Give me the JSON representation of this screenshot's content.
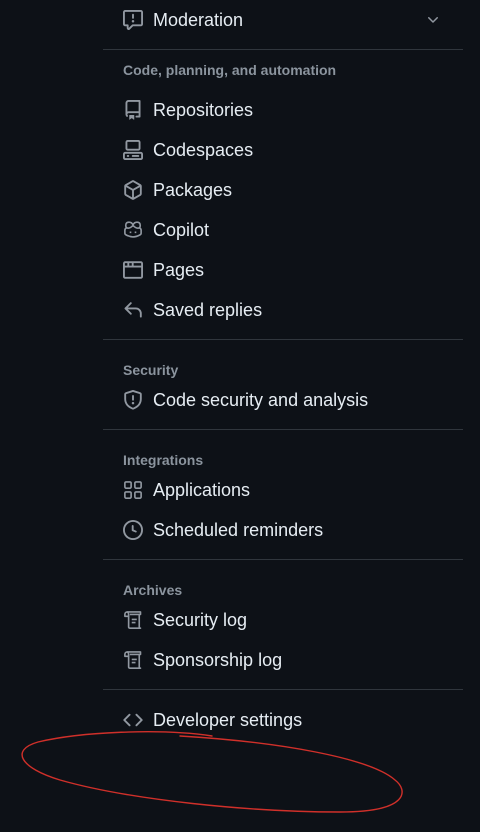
{
  "nav": {
    "moderation": {
      "label": "Moderation",
      "icon": "report-icon"
    },
    "code_planning": {
      "title": "Code, planning, and automation",
      "items": [
        {
          "label": "Repositories",
          "icon": "repo-icon"
        },
        {
          "label": "Codespaces",
          "icon": "codespaces-icon"
        },
        {
          "label": "Packages",
          "icon": "package-icon"
        },
        {
          "label": "Copilot",
          "icon": "copilot-icon"
        },
        {
          "label": "Pages",
          "icon": "browser-icon"
        },
        {
          "label": "Saved replies",
          "icon": "reply-icon"
        }
      ]
    },
    "security": {
      "title": "Security",
      "items": [
        {
          "label": "Code security and analysis",
          "icon": "shield-icon"
        }
      ]
    },
    "integrations": {
      "title": "Integrations",
      "items": [
        {
          "label": "Applications",
          "icon": "apps-icon"
        },
        {
          "label": "Scheduled reminders",
          "icon": "clock-icon"
        }
      ]
    },
    "archives": {
      "title": "Archives",
      "items": [
        {
          "label": "Security log",
          "icon": "log-icon"
        },
        {
          "label": "Sponsorship log",
          "icon": "log-icon"
        }
      ]
    },
    "developer": {
      "label": "Developer settings",
      "icon": "code-icon"
    }
  },
  "colors": {
    "background": "#0d1117",
    "text": "#e6edf3",
    "muted": "#8b949e",
    "divider": "#30363d",
    "annotation": "#d0302a"
  }
}
